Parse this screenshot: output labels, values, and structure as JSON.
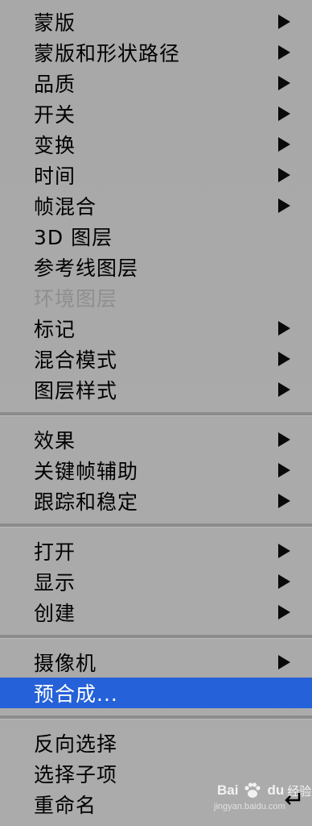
{
  "menu": {
    "groups": [
      [
        {
          "label": "蒙版",
          "submenu": true
        },
        {
          "label": "蒙版和形状路径",
          "submenu": true
        },
        {
          "label": "品质",
          "submenu": true
        },
        {
          "label": "开关",
          "submenu": true
        },
        {
          "label": "变换",
          "submenu": true
        },
        {
          "label": "时间",
          "submenu": true
        },
        {
          "label": "帧混合",
          "submenu": true
        },
        {
          "label": "3D 图层",
          "submenu": false
        },
        {
          "label": "参考线图层",
          "submenu": false
        },
        {
          "label": "环境图层",
          "submenu": false,
          "disabled": true
        },
        {
          "label": "标记",
          "submenu": true
        },
        {
          "label": "混合模式",
          "submenu": true
        },
        {
          "label": "图层样式",
          "submenu": true
        }
      ],
      [
        {
          "label": "效果",
          "submenu": true
        },
        {
          "label": "关键帧辅助",
          "submenu": true
        },
        {
          "label": "跟踪和稳定",
          "submenu": true
        }
      ],
      [
        {
          "label": "打开",
          "submenu": true
        },
        {
          "label": "显示",
          "submenu": true
        },
        {
          "label": "创建",
          "submenu": true
        }
      ],
      [
        {
          "label": "摄像机",
          "submenu": true
        },
        {
          "label": "预合成...",
          "submenu": false,
          "selected": true
        }
      ],
      [
        {
          "label": "反向选择",
          "submenu": false
        },
        {
          "label": "选择子项",
          "submenu": false
        },
        {
          "label": "重命名",
          "submenu": false,
          "shortcut_icon": "return-key-icon"
        }
      ]
    ],
    "colors": {
      "background": "#a9a9a9",
      "selected": "#2561d8",
      "disabled_text": "#8f8f8f"
    }
  },
  "watermark": {
    "logo_text": "Bai",
    "logo_text_2": "du",
    "suffix": "经验",
    "url": "jingyan.baidu.com"
  }
}
